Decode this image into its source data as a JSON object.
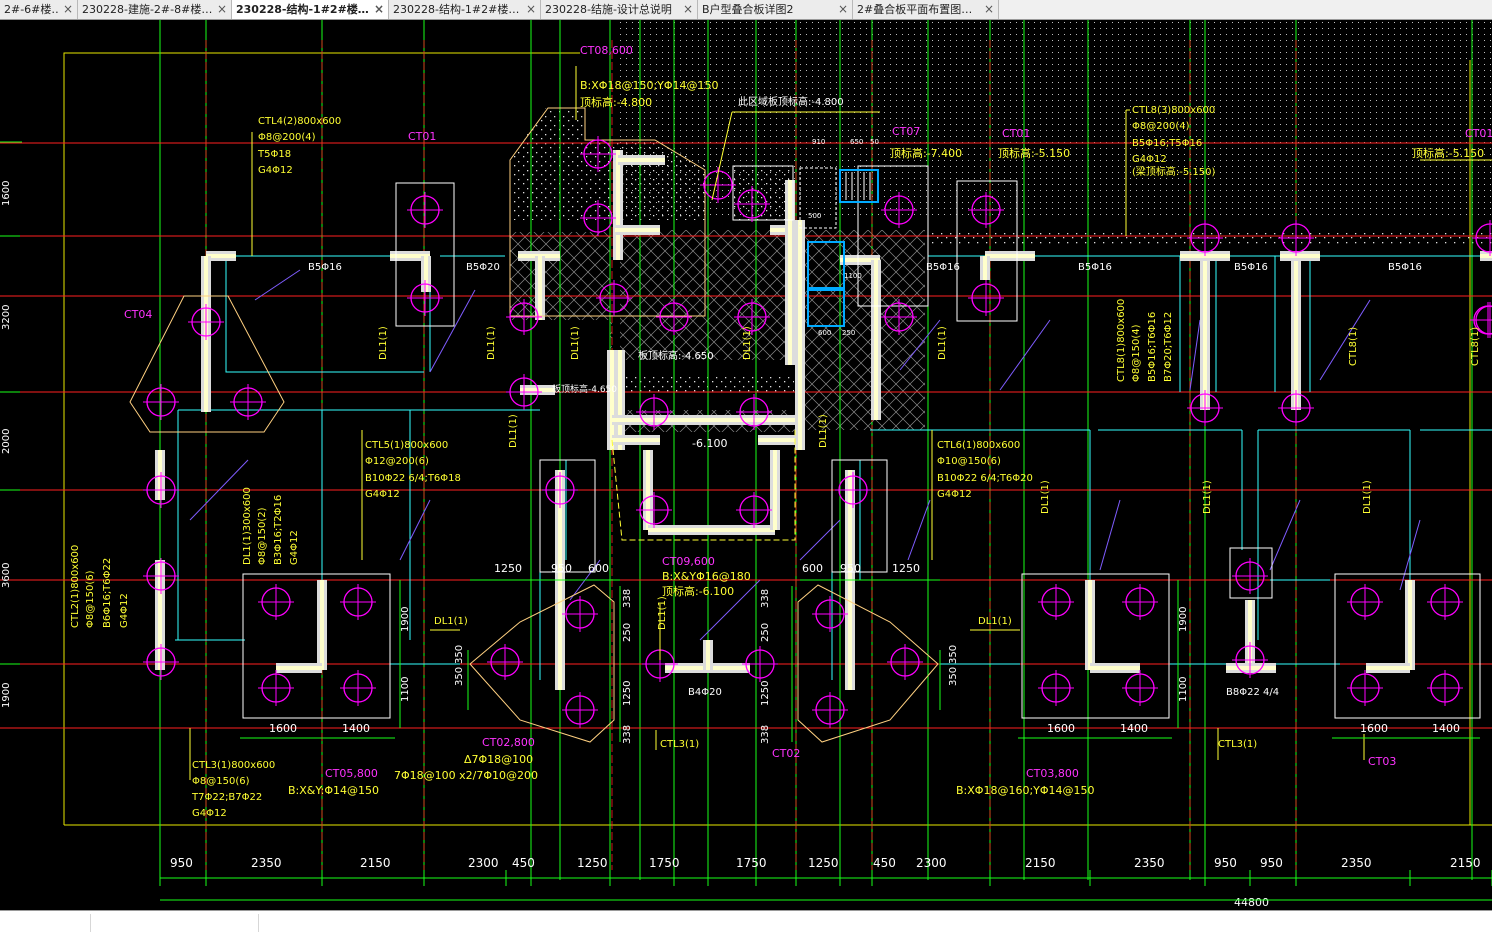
{
  "tabs": [
    {
      "label": "2#-6#楼…",
      "active": false
    },
    {
      "label": "230228-建施-2#-8#楼…",
      "active": false
    },
    {
      "label": "230228-结构-1#2#楼…",
      "active": true
    },
    {
      "label": "230228-结构-1#2#楼…",
      "active": false
    },
    {
      "label": "230228-结施-设计总说明",
      "active": false
    },
    {
      "label": "B户型叠合板详图2",
      "active": false
    },
    {
      "label": "2#叠合板平面布置图…",
      "active": false
    }
  ],
  "tab_close_glyph": "×",
  "colors": {
    "background": "#000000",
    "grid_red": "#ff2020",
    "grid_green": "#19ff19",
    "text_yellow": "#ffff33",
    "pile_magenta": "#ff00ff",
    "line_cyan": "#33ffff",
    "wall_white": "#ffffff"
  },
  "drawing": {
    "bottom_dims": [
      "950",
      "2350",
      "2150",
      "2300",
      "450",
      "1250",
      "1750",
      "1750",
      "1250",
      "450",
      "2300",
      "2150",
      "2350",
      "950",
      "950",
      "2350",
      "2150"
    ],
    "total_dim": "44800",
    "left_dims": [
      "1600",
      "3200",
      "2000",
      "3600",
      "1900"
    ],
    "caps": {
      "ct08": {
        "name": "CT08,600",
        "rebar": "B:XΦ18@150;YΦ14@150",
        "elev": "顶标高:-4.800"
      },
      "ct07": {
        "name": "CT07",
        "elev": "顶标高:-7.400"
      },
      "ct01a": {
        "name": "CT01",
        "elev": "顶标高:-5.150"
      },
      "ct01b": {
        "name": "CT01",
        "elev": "顶标高:-5.150"
      },
      "ct01c": "CT01",
      "ct04": "CT04",
      "ct09": {
        "name": "CT09,600",
        "rebar": "B:X&YΦ16@180",
        "elev": "顶标高:-6.100"
      },
      "ct02a": {
        "name": "CT02,800",
        "rebar1": "Δ7Φ18@100",
        "rebar2": "7Φ18@100 x2/7Φ10@200"
      },
      "ct02b": "CT02",
      "ct05": {
        "name": "CT05,800",
        "rebar": "B:X&Y:Φ14@150"
      },
      "ct03a": {
        "name": "CT03,800",
        "rebar": "B:XΦ18@160;YΦ14@150"
      },
      "ct03b": "CT03"
    },
    "area_note": "此区域板顶标高:-4.800",
    "slab_elev": "板顶标高:-4.650",
    "pit_elev": "-6.100",
    "corner_elev": "板顶标高-4.650",
    "beams": {
      "ctl4": [
        "CTL4(2)800x600",
        "Φ8@200(4)",
        "T5Φ18",
        "G4Φ12"
      ],
      "ctl8": [
        "CTL8(3)800x600",
        "Φ8@200(4)",
        "B5Φ16;T5Φ16",
        "G4Φ12",
        "(梁顶标高:-5.150)"
      ],
      "ctl5": [
        "CTL5(1)800x600",
        "Φ12@200(6)",
        "B10Φ22 6/4;T6Φ18",
        "G4Φ12"
      ],
      "ctl6": [
        "CTL6(1)800x600",
        "Φ10@150(6)",
        "B10Φ22 6/4;T6Φ20",
        "G4Φ12"
      ],
      "dl1_vert": [
        "DL1(1)300x600",
        "Φ8@150(2)",
        "B3Φ16;T2Φ16",
        "G4Φ12"
      ],
      "ctl2": [
        "CTL2(1)800x600",
        "Φ8@150(6)",
        "B6Φ16;T6Φ22",
        "G4Φ12"
      ],
      "ctl3": [
        "CTL3(1)800x600",
        "Φ8@150(6)",
        "T7Φ22;B7Φ22",
        "G4Φ12"
      ],
      "ctl8v": [
        "CTL8(1)800x600",
        "Φ8@150(4)",
        "B5Φ16;T6Φ16",
        "B7Φ20;T6Φ12",
        "G4Φ12"
      ]
    },
    "labels": {
      "b5_16": "B5Φ16",
      "b5_20": "B5Φ20",
      "dl1": "DL1(1)",
      "ctl3_1": "CTL3(1)",
      "ctl8_1": "CTL8(1)",
      "b4_20": "B4Φ20",
      "b8_22": "B8Φ22 4/4"
    },
    "local_dims": {
      "d1250": "1250",
      "d950": "950",
      "d600": "600",
      "d338": "338",
      "d250": "250",
      "d350": "350",
      "d1900": "1900",
      "d1100": "1100",
      "d1600": "1600",
      "d1400": "1400"
    },
    "equip": {
      "e910": "910",
      "e650": "650",
      "e50": "50",
      "e500": "500",
      "e600": "600",
      "e250": "250",
      "e1100": "1100"
    }
  }
}
